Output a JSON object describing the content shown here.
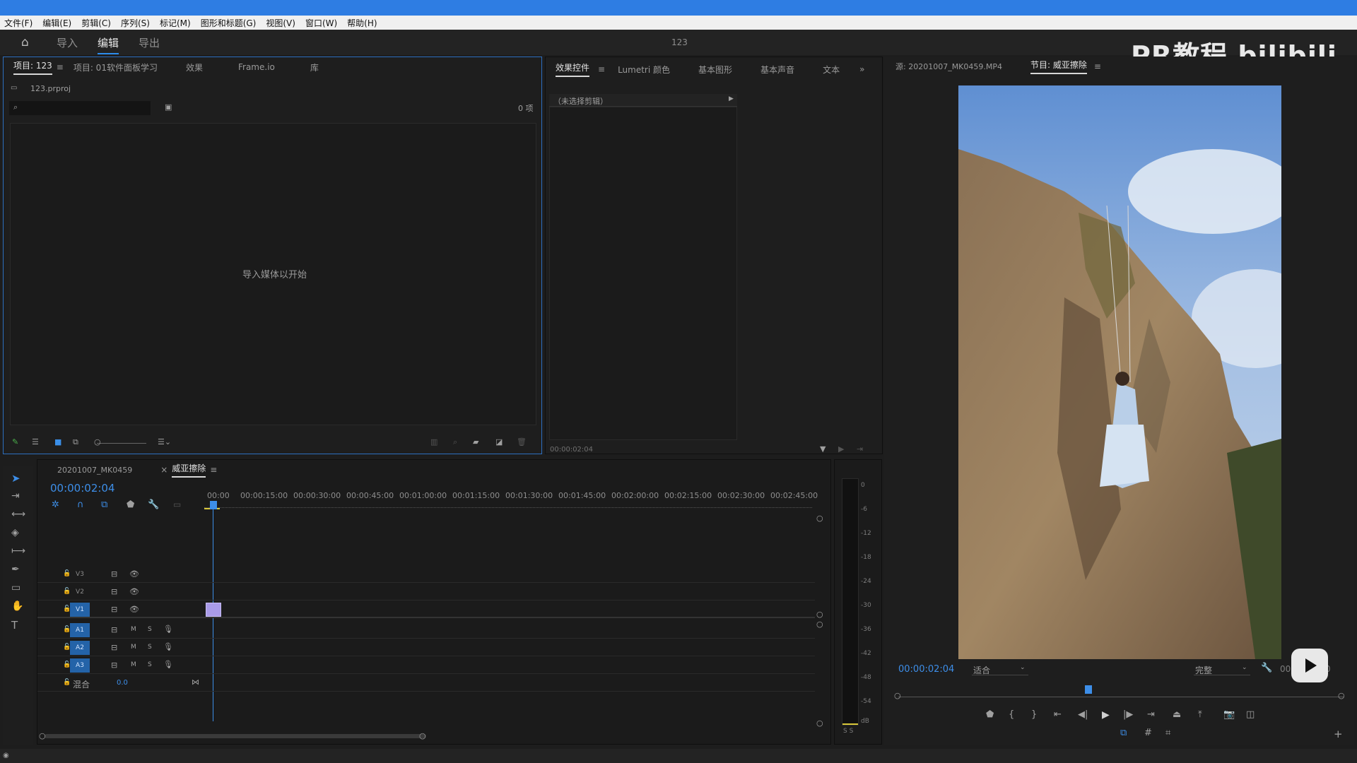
{
  "menu": [
    "文件(F)",
    "编辑(E)",
    "剪辑(C)",
    "序列(S)",
    "标记(M)",
    "图形和标题(G)",
    "视图(V)",
    "窗口(W)",
    "帮助(H)"
  ],
  "workspace": {
    "import": "导入",
    "edit": "编辑",
    "export": "导出",
    "project_name": "123"
  },
  "watermark": "PR教程 bilibili",
  "project_panel": {
    "tabs": [
      "项目: 123",
      "项目: 01软件面板学习",
      "效果",
      "Frame.io",
      "库"
    ],
    "file": "123.prproj",
    "count": "0 项",
    "empty_text": "导入媒体以开始"
  },
  "effects_panel": {
    "tabs": [
      "效果控件",
      "Lumetri 颜色",
      "基本图形",
      "基本声音",
      "文本"
    ],
    "no_clip": "（未选择剪辑）",
    "timecode": "00:00:02:04"
  },
  "program_panel": {
    "source_tab": "源: 20201007_MK0459.MP4",
    "program_tab": "节目: 威亚擦除",
    "timecode": "00:00:02:04",
    "fit": "适合",
    "quality": "完整",
    "end_time": "00:00:0_:00"
  },
  "timeline": {
    "tabs": [
      "20201007_MK0459",
      "威亚擦除"
    ],
    "timecode": "00:00:02:04",
    "ruler": [
      "00:00",
      "00:00:15:00",
      "00:00:30:00",
      "00:00:45:00",
      "00:01:00:00",
      "00:01:15:00",
      "00:01:30:00",
      "00:01:45:00",
      "00:02:00:00",
      "00:02:15:00",
      "00:02:30:00",
      "00:02:45:00"
    ],
    "video_tracks": [
      "V3",
      "V2",
      "V1"
    ],
    "audio_tracks": [
      "A1",
      "A2",
      "A3"
    ],
    "mix_label": "混合",
    "mix_value": "0.0"
  },
  "audio_meter": {
    "labels": [
      "0",
      "-6",
      "-12",
      "-18",
      "-24",
      "-30",
      "-36",
      "-42",
      "-48",
      "-54",
      "dB"
    ],
    "solo": "S S"
  },
  "colors": {
    "accent": "#2d8ceb",
    "timecode": "#3d8ee8",
    "clip": "#a99be8",
    "sky": "#6f9bd6"
  }
}
